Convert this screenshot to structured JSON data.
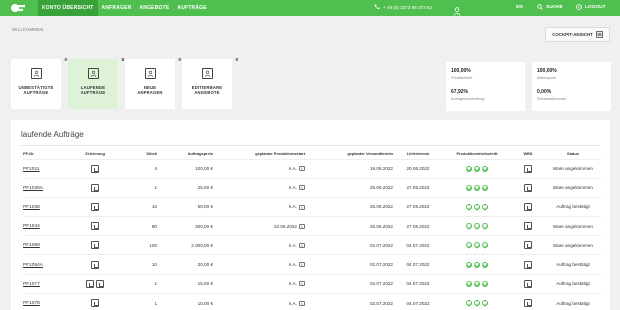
{
  "nav": {
    "items": [
      "KONTO ÜBERSICHT",
      "ANFRAGEN",
      "ANGEBOTE",
      "AUFTRÄGE"
    ],
    "phone": "+ 49 (0) 2373 95 373 62",
    "lang": "EN",
    "search": "SUCHE",
    "logout": "LOGOUT"
  },
  "welcome": "WILLKOMMEN",
  "cockpit": "COCKPIT-ANSICHT",
  "cards": [
    {
      "label1": "UNBESTÄTIGTE",
      "label2": "AUFTRÄGE",
      "count": "0"
    },
    {
      "label1": "LAUFENDE",
      "label2": "AUFTRÄGE",
      "count": "8"
    },
    {
      "label1": "NEUE",
      "label2": "ANFRAGEN",
      "count": "0"
    },
    {
      "label1": "EDITIERBARE",
      "label2": "ANGEBOTE",
      "count": "0"
    }
  ],
  "stats": [
    {
      "v1": "100,00%",
      "l1": "Pünktlichkeit",
      "v2": "67,92%",
      "l2": "Anfragebearbeitung"
    },
    {
      "v1": "100,00%",
      "l1": "Mahnquote",
      "v2": "0,00%",
      "l2": "Reklamationsrate"
    }
  ],
  "panel_title": "laufende Aufträge",
  "columns": [
    "PF-Nr.",
    "Zeichnung",
    "Stück",
    "Auftragspreis",
    "geplanter Produktionsstart",
    "geplanter Versandtermin",
    "Liefertermin",
    "Produktionsfortschritt",
    "WBS",
    "Status"
  ],
  "rows": [
    {
      "pf": "PF1011",
      "stueck": "4",
      "preis": "100,00 €",
      "start": "k.A.",
      "versand": "18.06.2022",
      "liefer": "20.06.2022",
      "status": "Ware angekommen",
      "docs": 1
    },
    {
      "pf": "PF1035A",
      "stueck": "1",
      "preis": "25,00 €",
      "start": "k.A.",
      "versand": "25.06.2022",
      "liefer": "27.06.2022",
      "status": "Ware angekommen",
      "docs": 1
    },
    {
      "pf": "PF1038",
      "stueck": "15",
      "preis": "50,00 €",
      "start": "k.A.",
      "versand": "25.06.2022",
      "liefer": "27.06.2022",
      "status": "Auftrag bestätigt",
      "docs": 1
    },
    {
      "pf": "PF1044",
      "stueck": "90",
      "preis": "300,00 €",
      "start": "22.06.2022",
      "versand": "25.06.2022",
      "liefer": "27.06.2022",
      "status": "Ware angekommen",
      "docs": 1
    },
    {
      "pf": "PF1069",
      "stueck": "100",
      "preis": "2.000,00 €",
      "start": "k.A.",
      "versand": "02.07.2022",
      "liefer": "04.07.2022",
      "status": "Ware angekommen",
      "docs": 1
    },
    {
      "pf": "PF1054A",
      "stueck": "10",
      "preis": "20,00 €",
      "start": "k.A.",
      "versand": "02.07.2022",
      "liefer": "04.07.2022",
      "status": "Auftrag bestätigt",
      "docs": 1
    },
    {
      "pf": "PF1077",
      "stueck": "1",
      "preis": "15,00 €",
      "start": "k.A.",
      "versand": "02.07.2022",
      "liefer": "04.07.2022",
      "status": "Auftrag bestätigt",
      "docs": 2
    },
    {
      "pf": "PF1078",
      "stueck": "1",
      "preis": "10,00 €",
      "start": "k.A.",
      "versand": "02.07.2022",
      "liefer": "04.07.2022",
      "status": "Auftrag bestätigt",
      "docs": 1
    }
  ]
}
